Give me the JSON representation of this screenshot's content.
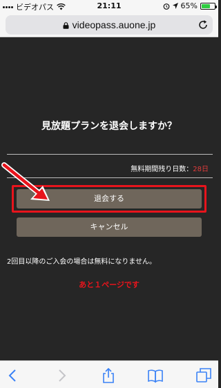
{
  "status_bar": {
    "carrier": "ビデオパス",
    "time": "21:11",
    "battery_percent": "65%",
    "battery_level": 0.65
  },
  "browser": {
    "url": "videopass.auone.jp"
  },
  "page": {
    "title": "見放題プランを退会しますか？",
    "trial_label": "無料期間残り日数：",
    "trial_days": "28日",
    "withdraw_button": "退会する",
    "cancel_button": "キャンセル",
    "note": "2回目以降のご入会の場合は無料になりません。",
    "remaining": "あと１ページです"
  },
  "colors": {
    "highlight": "#e8141c",
    "button": "#6f665b",
    "toolbar_icon": "#3a82f6"
  },
  "icons": {
    "lock": "lock-icon",
    "reload": "reload-icon",
    "back": "chevron-left-icon",
    "forward": "chevron-right-icon",
    "share": "share-icon",
    "bookmarks": "book-icon",
    "tabs": "tabs-icon"
  }
}
